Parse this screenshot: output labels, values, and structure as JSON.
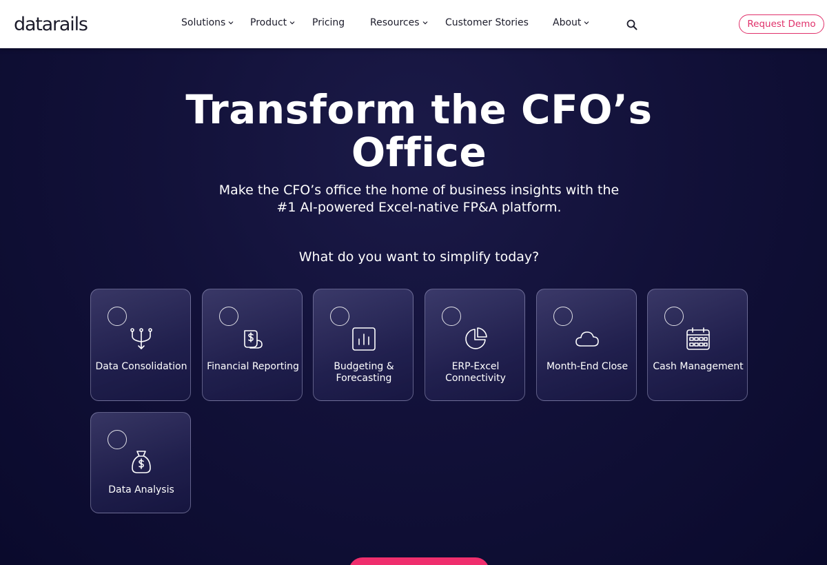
{
  "header": {
    "logo_text": "datarails",
    "nav": [
      {
        "label": "Solutions",
        "has_dropdown": true
      },
      {
        "label": "Product",
        "has_dropdown": true
      },
      {
        "label": "Pricing",
        "has_dropdown": false
      },
      {
        "label": "Resources",
        "has_dropdown": true
      },
      {
        "label": "Customer Stories",
        "has_dropdown": false
      },
      {
        "label": "About",
        "has_dropdown": true
      }
    ],
    "search_icon": "search-icon",
    "cta_label": "Request Demo"
  },
  "hero": {
    "title": "Transform the CFO’s Office",
    "subtitle": "Make the CFO’s office the home of business insights with the #1 AI-powered Excel-native FP&A platform.",
    "question": "What do you want to simplify today?",
    "options": [
      {
        "label": "Data Consolidation",
        "icon": "merge-arrows-icon"
      },
      {
        "label": "Financial Reporting",
        "icon": "dollar-report-icon"
      },
      {
        "label": "Budgeting & Forecasting",
        "icon": "bar-chart-icon"
      },
      {
        "label": "ERP-Excel Connectivity",
        "icon": "pie-chart-icon"
      },
      {
        "label": "Month-End Close",
        "icon": "cloud-icon"
      },
      {
        "label": "Cash Management",
        "icon": "calendar-icon"
      },
      {
        "label": "Data Analysis",
        "icon": "money-bag-icon"
      }
    ]
  },
  "colors": {
    "accent": "#ef2e6d",
    "background": "#0c0b2e",
    "logo_dot": "#f4a300"
  }
}
